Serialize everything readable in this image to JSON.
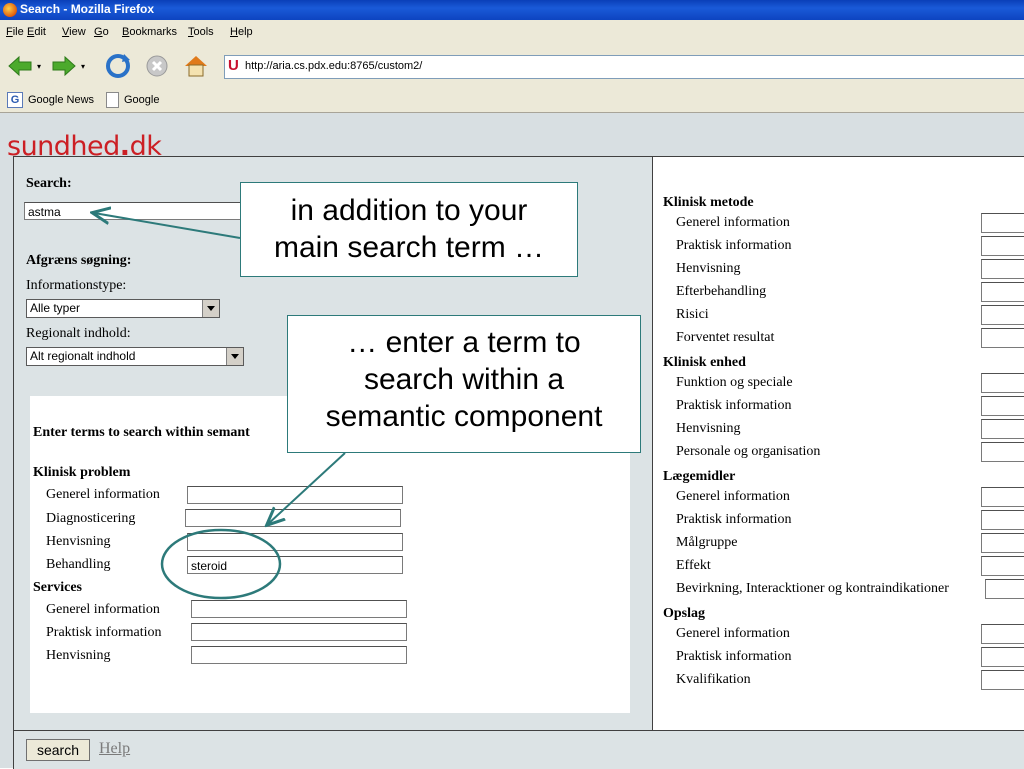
{
  "window": {
    "title": "Search - Mozilla Firefox"
  },
  "menu": {
    "items": [
      "File",
      "Edit",
      "View",
      "Go",
      "Bookmarks",
      "Tools",
      "Help"
    ]
  },
  "nav": {
    "url": "http://aria.cs.pdx.edu:8765/custom2/"
  },
  "bookmarks": {
    "items": [
      "Google News",
      "Google"
    ]
  },
  "logo": {
    "text_a": "sundhed",
    "text_b": "dk"
  },
  "left": {
    "search_label": "Search:",
    "search_value": "astma",
    "refine_heading": "Afgræns søgning:",
    "info_type_label": "Informationstype:",
    "info_type_value": "Alle typer",
    "regional_label": "Regionalt indhold:",
    "regional_value": "Alt regionalt indhold",
    "semantic_heading": "Enter terms to search within semant",
    "groups": [
      {
        "heading": "Klinisk problem",
        "fields": [
          {
            "label": "Generel information",
            "value": ""
          },
          {
            "label": "Diagnosticering",
            "value": ""
          },
          {
            "label": "Henvisning",
            "value": ""
          },
          {
            "label": "Behandling",
            "value": "steroid"
          }
        ]
      },
      {
        "heading": "Services",
        "fields": [
          {
            "label": "Generel information",
            "value": ""
          },
          {
            "label": "Praktisk information",
            "value": ""
          },
          {
            "label": "Henvisning",
            "value": ""
          }
        ]
      }
    ]
  },
  "right": {
    "groups": [
      {
        "heading": "Klinisk metode",
        "fields": [
          "Generel information",
          "Praktisk information",
          "Henvisning",
          "Efterbehandling",
          "Risici",
          "Forventet resultat"
        ]
      },
      {
        "heading": "Klinisk enhed",
        "fields": [
          "Funktion og speciale",
          "Praktisk information",
          "Henvisning",
          "Personale og organisation"
        ]
      },
      {
        "heading": "Lægemidler",
        "fields": [
          "Generel information",
          "Praktisk information",
          "Målgruppe",
          "Effekt",
          "Bevirkning, Interacktioner og kontraindikationer"
        ]
      },
      {
        "heading": "Opslag",
        "fields": [
          "Generel information",
          "Praktisk information",
          "Kvalifikation"
        ]
      }
    ]
  },
  "bottom": {
    "search_button": "search",
    "help_link": "Help"
  },
  "annotations": {
    "callout1_line1": "in addition to your",
    "callout1_line2": "main search term …",
    "callout2_line1": "… enter a term to",
    "callout2_line2": "search within a",
    "callout2_line3": "semantic component"
  },
  "colors": {
    "logo": "#cc1f24",
    "annotation": "#2d7a7a",
    "page_bg": "#d8dfe2"
  }
}
